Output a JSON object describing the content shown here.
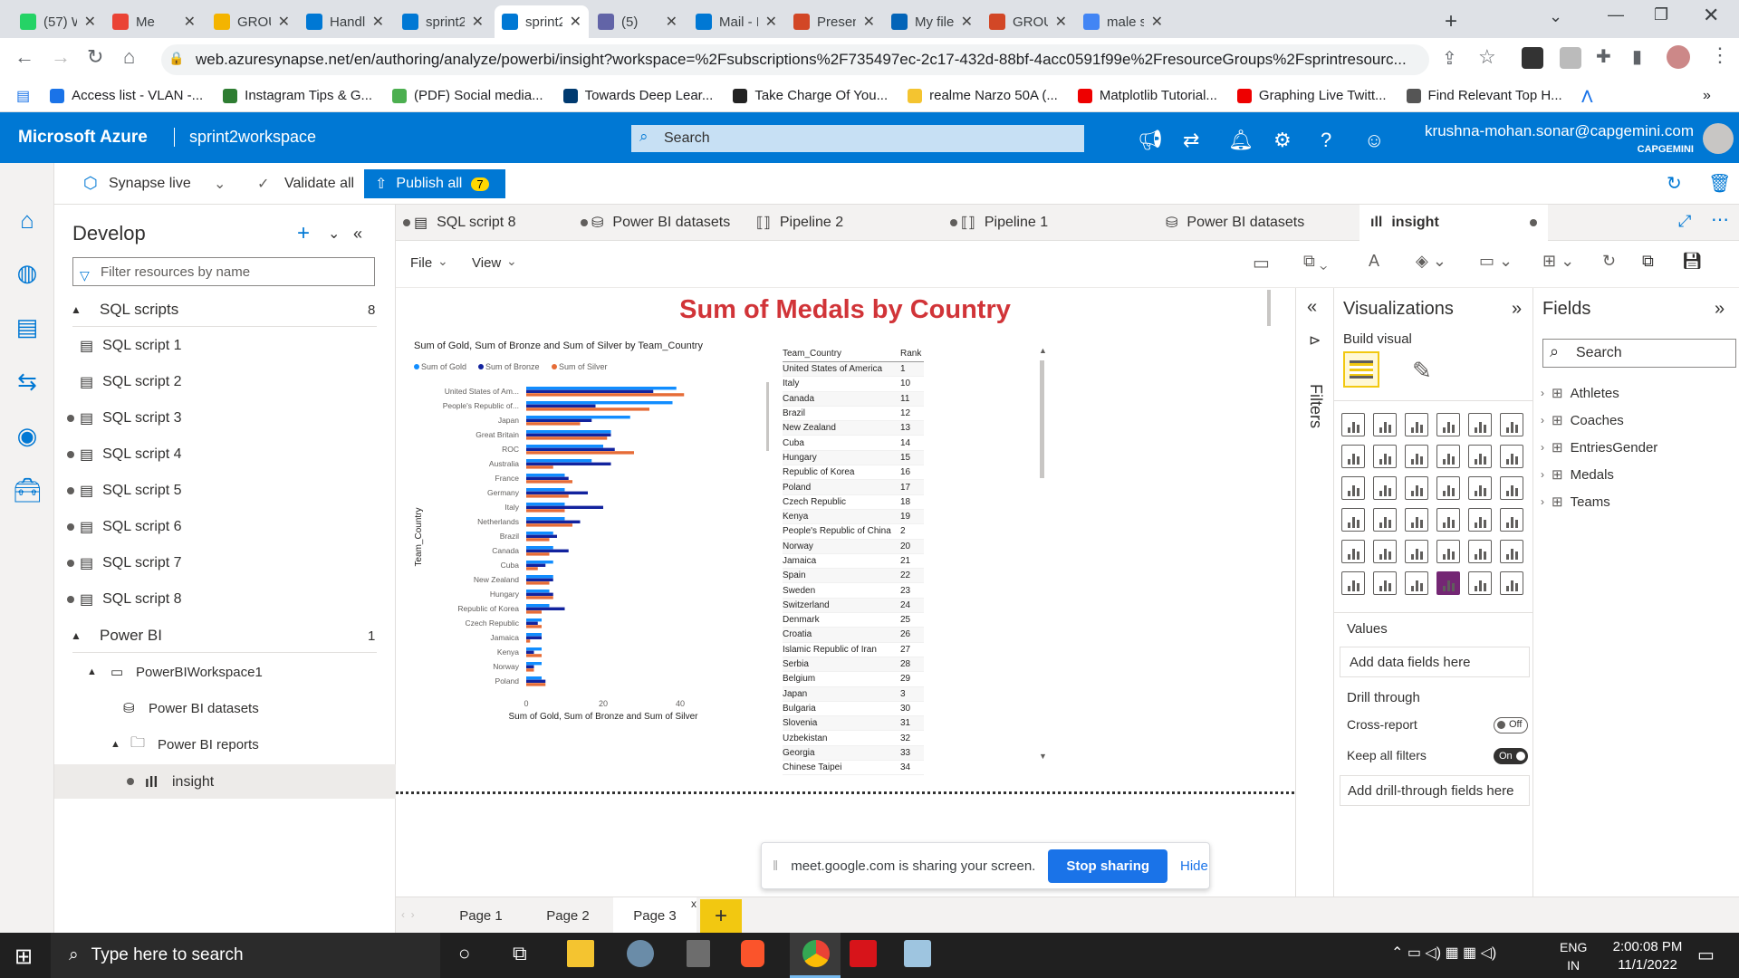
{
  "browser_tabs": [
    {
      "label": "(57) Wh",
      "color": "#25d366"
    },
    {
      "label": "Me",
      "color": "#ea4335"
    },
    {
      "label": "GROUP",
      "color": "#f4b400"
    },
    {
      "label": "Handlin",
      "color": "#0078d4"
    },
    {
      "label": "sprint2v",
      "color": "#0078d4"
    },
    {
      "label": "sprint2v",
      "color": "#0078d4"
    },
    {
      "label": "(5)",
      "color": "#6264a7"
    },
    {
      "label": "Mail - P",
      "color": "#0078d4"
    },
    {
      "label": "Present",
      "color": "#d24726"
    },
    {
      "label": "My files",
      "color": "#0364b8"
    },
    {
      "label": "GROUP",
      "color": "#d24726"
    },
    {
      "label": "male sy",
      "color": "#4285f4"
    }
  ],
  "url": "web.azuresynapse.net/en/authoring/analyze/powerbi/insight?workspace=%2Fsubscriptions%2F735497ec-2c17-432d-88bf-4acc0591f99e%2FresourceGroups%2Fsprintresourc...",
  "bookmarks": [
    "Access list - VLAN -...",
    "Instagram Tips & G...",
    "(PDF) Social media...",
    "Towards Deep Lear...",
    "Take Charge Of You...",
    "realme Narzo 50A (...",
    "Matplotlib Tutorial...",
    "Graphing Live Twitt...",
    "Find Relevant Top H..."
  ],
  "azure": {
    "brand": "Microsoft Azure",
    "workspace": "sprint2workspace",
    "search_placeholder": "Search",
    "user_email": "krushna-mohan.sonar@capgemini.com",
    "user_org": "CAPGEMINI"
  },
  "toolbar": {
    "mode": "Synapse live",
    "validate": "Validate all",
    "publish": "Publish all",
    "publish_count": "7"
  },
  "develop": {
    "title": "Develop",
    "filter_placeholder": "Filter resources by name",
    "sql_section": "SQL scripts",
    "sql_count": "8",
    "sql_items": [
      "SQL script 1",
      "SQL script 2",
      "SQL script 3",
      "SQL script 4",
      "SQL script 5",
      "SQL script 6",
      "SQL script 7",
      "SQL script 8"
    ],
    "pbi_section": "Power BI",
    "pbi_count": "1",
    "workspace": "PowerBIWorkspace1",
    "datasets": "Power BI datasets",
    "reports": "Power BI reports",
    "insight": "insight"
  },
  "editor_tabs": [
    "SQL script 8",
    "Power BI datasets",
    "Pipeline 2",
    "Pipeline 1",
    "Power BI datasets",
    "insight"
  ],
  "report_menu": {
    "file": "File",
    "view": "View"
  },
  "report": {
    "title": "Sum of Medals by Country"
  },
  "chart_data": {
    "type": "bar",
    "orientation": "horizontal",
    "title": "Sum of Gold, Sum of Bronze and Sum of Silver by Team_Country",
    "xlabel": "Sum of Gold, Sum of Bronze and Sum of Silver",
    "ylabel": "Team_Country",
    "xlim": [
      0,
      45
    ],
    "xticks": [
      "0",
      "20",
      "40"
    ],
    "legend_position": "top-left",
    "categories": [
      "United States of Am...",
      "People's Republic of...",
      "Japan",
      "Great Britain",
      "ROC",
      "Australia",
      "France",
      "Germany",
      "Italy",
      "Netherlands",
      "Brazil",
      "Canada",
      "Cuba",
      "New Zealand",
      "Hungary",
      "Republic of Korea",
      "Czech Republic",
      "Jamaica",
      "Kenya",
      "Norway",
      "Poland"
    ],
    "series": [
      {
        "name": "Sum of Gold",
        "color": "#118dff",
        "values": [
          39,
          38,
          27,
          22,
          20,
          17,
          10,
          10,
          10,
          10,
          7,
          7,
          7,
          7,
          6,
          6,
          4,
          4,
          4,
          4,
          4
        ]
      },
      {
        "name": "Sum of Bronze",
        "color": "#12239e",
        "values": [
          33,
          18,
          17,
          22,
          23,
          22,
          11,
          16,
          20,
          14,
          8,
          11,
          5,
          7,
          7,
          10,
          3,
          4,
          2,
          2,
          5
        ]
      },
      {
        "name": "Sum of Silver",
        "color": "#e66c37",
        "values": [
          41,
          32,
          14,
          21,
          28,
          7,
          12,
          11,
          10,
          12,
          6,
          6,
          3,
          6,
          7,
          4,
          4,
          1,
          4,
          2,
          5
        ]
      }
    ]
  },
  "table": {
    "headers": [
      "Team_Country",
      "Rank"
    ],
    "rows": [
      [
        "United States of America",
        "1"
      ],
      [
        "Italy",
        "10"
      ],
      [
        "Canada",
        "11"
      ],
      [
        "Brazil",
        "12"
      ],
      [
        "New Zealand",
        "13"
      ],
      [
        "Cuba",
        "14"
      ],
      [
        "Hungary",
        "15"
      ],
      [
        "Republic of Korea",
        "16"
      ],
      [
        "Poland",
        "17"
      ],
      [
        "Czech Republic",
        "18"
      ],
      [
        "Kenya",
        "19"
      ],
      [
        "People's Republic of China",
        "2"
      ],
      [
        "Norway",
        "20"
      ],
      [
        "Jamaica",
        "21"
      ],
      [
        "Spain",
        "22"
      ],
      [
        "Sweden",
        "23"
      ],
      [
        "Switzerland",
        "24"
      ],
      [
        "Denmark",
        "25"
      ],
      [
        "Croatia",
        "26"
      ],
      [
        "Islamic Republic of Iran",
        "27"
      ],
      [
        "Serbia",
        "28"
      ],
      [
        "Belgium",
        "29"
      ],
      [
        "Japan",
        "3"
      ],
      [
        "Bulgaria",
        "30"
      ],
      [
        "Slovenia",
        "31"
      ],
      [
        "Uzbekistan",
        "32"
      ],
      [
        "Georgia",
        "33"
      ],
      [
        "Chinese Taipei",
        "34"
      ]
    ]
  },
  "filters_label": "Filters",
  "visualizations": {
    "title": "Visualizations",
    "build": "Build visual",
    "values": "Values",
    "values_placeholder": "Add data fields here",
    "drill": "Drill through",
    "cross": "Cross-report",
    "cross_state": "Off",
    "keep": "Keep all filters",
    "keep_state": "On",
    "drill_placeholder": "Add drill-through fields here"
  },
  "fields": {
    "title": "Fields",
    "search": "Search",
    "tables": [
      "Athletes",
      "Coaches",
      "EntriesGender",
      "Medals",
      "Teams"
    ]
  },
  "pages": [
    "Page 1",
    "Page 2",
    "Page 3"
  ],
  "share": {
    "text": "meet.google.com is sharing your screen.",
    "stop": "Stop sharing",
    "hide": "Hide"
  },
  "taskbar": {
    "search": "Type here to search",
    "lang1": "ENG",
    "lang2": "IN",
    "time": "2:00:08 PM",
    "date": "11/1/2022"
  }
}
